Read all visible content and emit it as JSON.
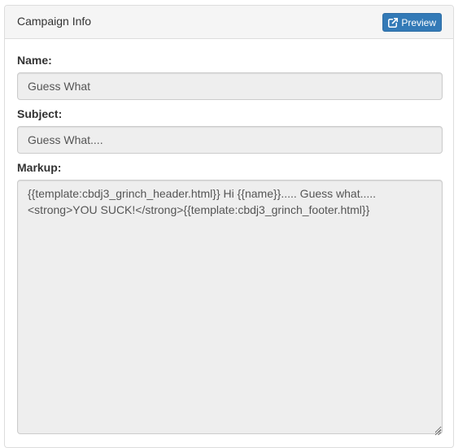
{
  "panel": {
    "title": "Campaign Info",
    "preview_button": {
      "label": "Preview",
      "icon": "external-link-icon",
      "color": "#337ab7"
    }
  },
  "form": {
    "name": {
      "label": "Name:",
      "value": "Guess What"
    },
    "subject": {
      "label": "Subject:",
      "value": "Guess What...."
    },
    "markup": {
      "label": "Markup:",
      "value": "{{template:cbdj3_grinch_header.html}} Hi {{name}}..... Guess what..... <strong>YOU SUCK!</strong>{{template:cbdj3_grinch_footer.html}}"
    }
  }
}
